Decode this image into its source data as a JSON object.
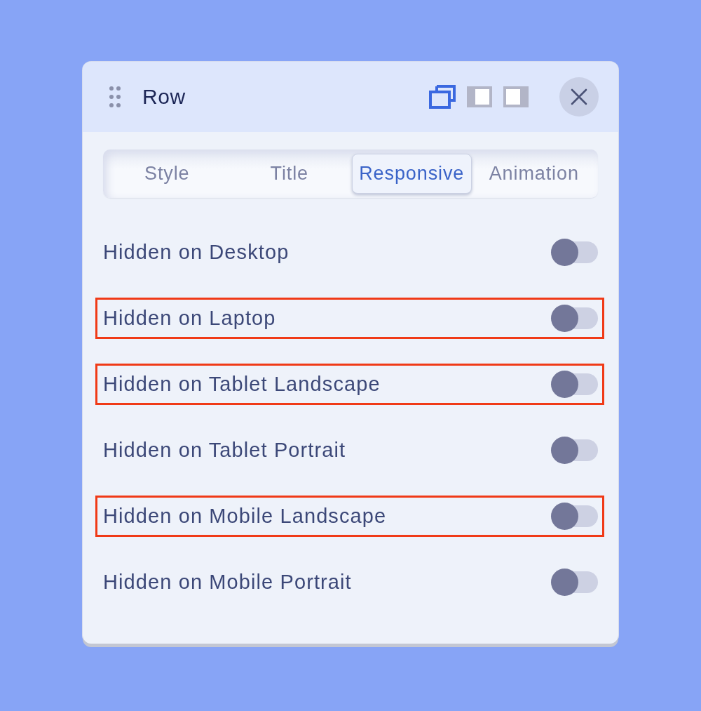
{
  "header": {
    "title": "Row",
    "layout_buttons": [
      {
        "kind": "overlay",
        "selected": true
      },
      {
        "kind": "left",
        "selected": false
      },
      {
        "kind": "right",
        "selected": false
      }
    ]
  },
  "tabs": [
    {
      "label": "Style",
      "selected": false
    },
    {
      "label": "Title",
      "selected": false
    },
    {
      "label": "Responsive",
      "selected": true
    },
    {
      "label": "Animation",
      "selected": false
    }
  ],
  "rows": [
    {
      "label": "Hidden on Desktop",
      "on": false,
      "highlighted": false
    },
    {
      "label": "Hidden on Laptop",
      "on": false,
      "highlighted": true
    },
    {
      "label": "Hidden on Tablet Landscape",
      "on": false,
      "highlighted": true
    },
    {
      "label": "Hidden on Tablet Portrait",
      "on": false,
      "highlighted": false
    },
    {
      "label": "Hidden on Mobile Landscape",
      "on": false,
      "highlighted": true
    },
    {
      "label": "Hidden on Mobile Portrait",
      "on": false,
      "highlighted": false
    }
  ]
}
